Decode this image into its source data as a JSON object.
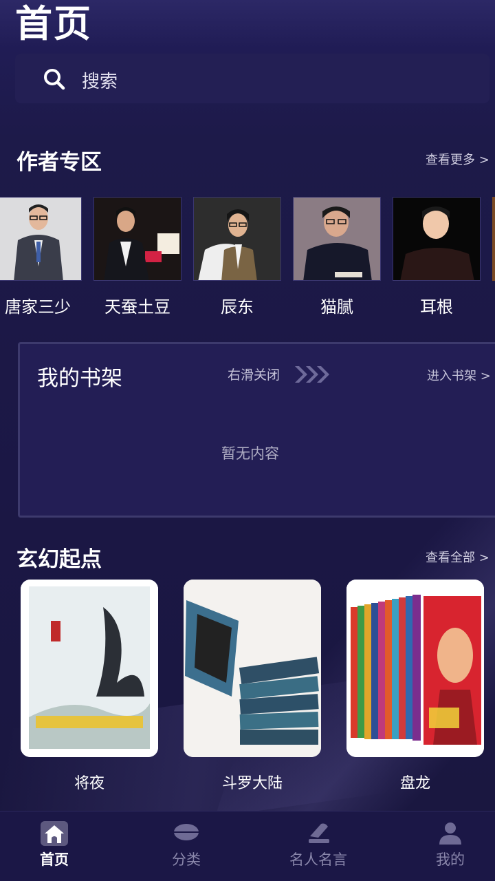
{
  "header": {
    "title": "首页"
  },
  "search": {
    "placeholder": "搜索"
  },
  "authors_section": {
    "title": "作者专区",
    "more_label": "查看更多 >",
    "authors": [
      {
        "name": "唐家三少"
      },
      {
        "name": "天蚕土豆"
      },
      {
        "name": "辰东"
      },
      {
        "name": "猫腻"
      },
      {
        "name": "耳根"
      }
    ]
  },
  "bookshelf": {
    "title": "我的书架",
    "swipe_hint": "右滑关闭",
    "enter_label": "进入书架 >",
    "empty_text": "暂无内容"
  },
  "fantasy_section": {
    "title": "玄幻起点",
    "more_label": "查看全部 >",
    "books": [
      {
        "title": "将夜"
      },
      {
        "title": "斗罗大陆"
      },
      {
        "title": "盘龙"
      }
    ]
  },
  "tabbar": {
    "tabs": [
      {
        "label": "首页",
        "icon": "home-icon",
        "active": true
      },
      {
        "label": "分类",
        "icon": "category-icon",
        "active": false
      },
      {
        "label": "名人名言",
        "icon": "quote-icon",
        "active": false
      },
      {
        "label": "我的",
        "icon": "profile-icon",
        "active": false
      }
    ]
  },
  "colors": {
    "background": "#1b1740",
    "card": "#231e55",
    "accent_text": "#ffffff",
    "muted_text": "#8a87ab"
  }
}
